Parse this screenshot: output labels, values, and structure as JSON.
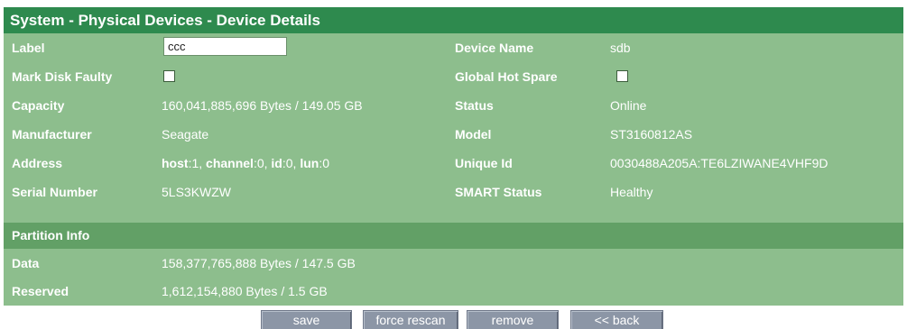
{
  "title": "System - Physical Devices - Device Details",
  "fields": {
    "label": {
      "label": "Label",
      "value": "ccc"
    },
    "device_name": {
      "label": "Device Name",
      "value": "sdb"
    },
    "mark_disk_faulty": {
      "label": "Mark Disk Faulty",
      "checked": false
    },
    "global_hot_spare": {
      "label": "Global Hot Spare",
      "checked": false
    },
    "capacity": {
      "label": "Capacity",
      "value": "160,041,885,696 Bytes / 149.05 GB"
    },
    "status": {
      "label": "Status",
      "value": "Online"
    },
    "manufacturer": {
      "label": "Manufacturer",
      "value": "Seagate"
    },
    "model": {
      "label": "Model",
      "value": "ST3160812AS"
    },
    "address": {
      "label": "Address",
      "host_key": "host",
      "host_value": ":1, ",
      "channel_key": "channel",
      "channel_value": ":0, ",
      "id_key": "id",
      "id_value": ":0, ",
      "lun_key": "lun",
      "lun_value": ":0"
    },
    "unique_id": {
      "label": "Unique Id",
      "value": "0030488A205A:TE6LZIWANE4VHF9D"
    },
    "serial_number": {
      "label": "Serial Number",
      "value": "5LS3KWZW"
    },
    "smart_status": {
      "label": "SMART Status",
      "value": "Healthy"
    }
  },
  "partition_info": {
    "heading": "Partition Info",
    "rows": [
      {
        "label": "Data",
        "value": "158,377,765,888 Bytes / 147.5 GB"
      },
      {
        "label": "Reserved",
        "value": "1,612,154,880 Bytes / 1.5 GB"
      }
    ]
  },
  "buttons": {
    "save": "save",
    "force_rescan": "force rescan",
    "remove": "remove",
    "back": "<< back"
  },
  "colors": {
    "title_bar": "#2e8a4e",
    "panel": "#8dbe8d",
    "section_bar": "#62a066",
    "button": "#8c96a6",
    "text": "#ffffff"
  }
}
